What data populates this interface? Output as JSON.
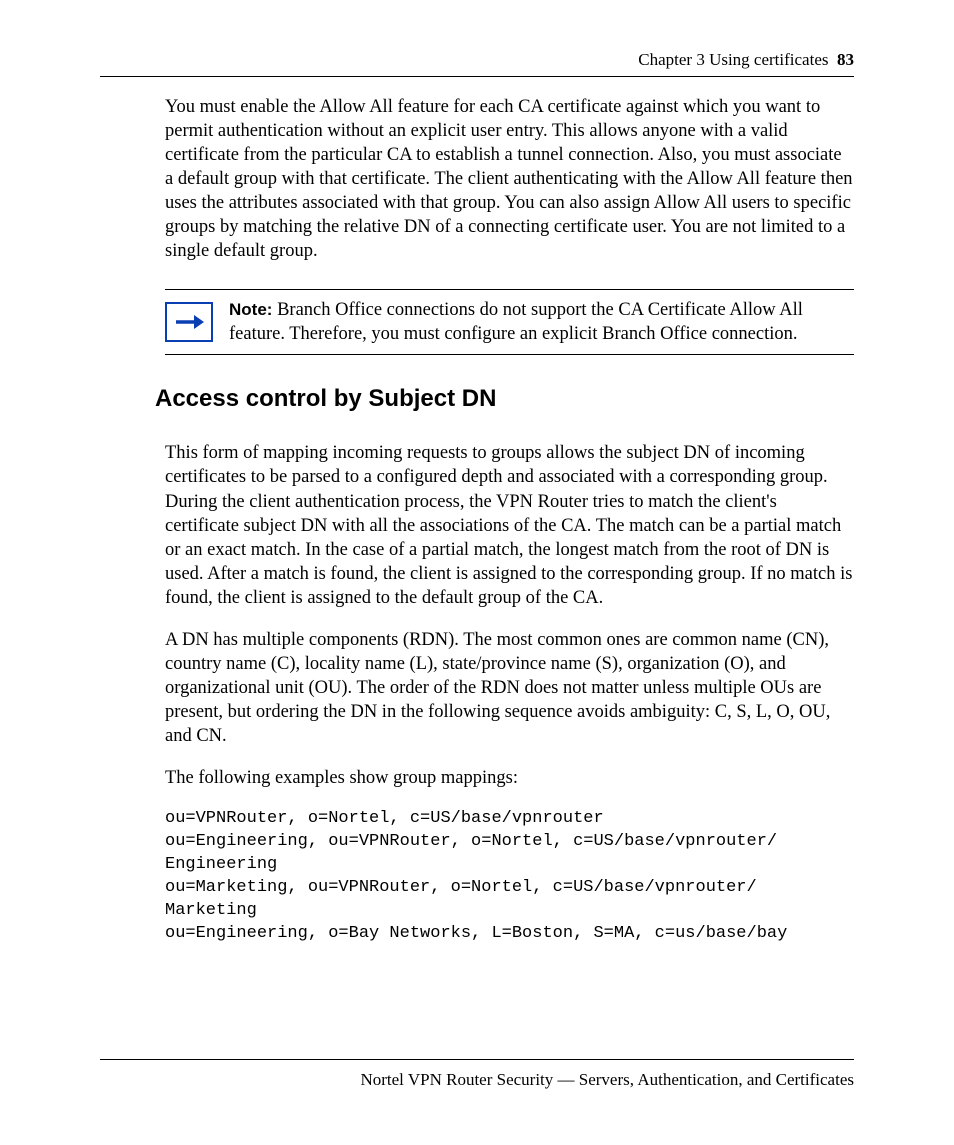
{
  "header": {
    "chapter": "Chapter 3  Using certificates",
    "page_number": "83"
  },
  "paragraphs": {
    "p1": "You must enable the Allow All feature for each CA certificate against which you want to permit authentication without an explicit user entry. This allows anyone with a valid certificate from the particular CA to establish a tunnel connection. Also, you must associate a default group with that certificate. The client authenticating with the Allow All feature then uses the attributes associated with that group. You can also assign Allow All users to specific groups by matching the relative DN of a connecting certificate user. You are not limited to a single default group."
  },
  "note": {
    "label": "Note:",
    "text": " Branch Office connections do not support the CA Certificate Allow All feature. Therefore, you must configure an explicit Branch Office connection."
  },
  "section_heading": "Access control by Subject DN",
  "body": {
    "p2": "This form of mapping incoming requests to groups allows the subject DN of incoming certificates to be parsed to a configured depth and associated with a corresponding group. During the client authentication process, the VPN Router tries to match the client's certificate subject DN with all the associations of the CA. The match can be a partial match or an exact match. In the case of a partial match, the longest match from the root of DN is used. After a match is found, the client is assigned to the corresponding group. If no match is found, the client is assigned to the default group of the CA.",
    "p3": "A DN has multiple components (RDN). The most common ones are common name (CN), country name (C), locality name (L), state/province name (S), organization (O), and organizational unit (OU). The order of the RDN does not matter unless multiple OUs are present, but ordering the DN in the following sequence avoids ambiguity: C, S, L, O, OU, and CN.",
    "p4": "The following examples show group mappings:"
  },
  "code": "ou=VPNRouter, o=Nortel, c=US/base/vpnrouter\nou=Engineering, ou=VPNRouter, o=Nortel, c=US/base/vpnrouter/\nEngineering\nou=Marketing, ou=VPNRouter, o=Nortel, c=US/base/vpnrouter/\nMarketing\nou=Engineering, o=Bay Networks, L=Boston, S=MA, c=us/base/bay",
  "footer": "Nortel VPN Router Security — Servers, Authentication, and Certificates"
}
